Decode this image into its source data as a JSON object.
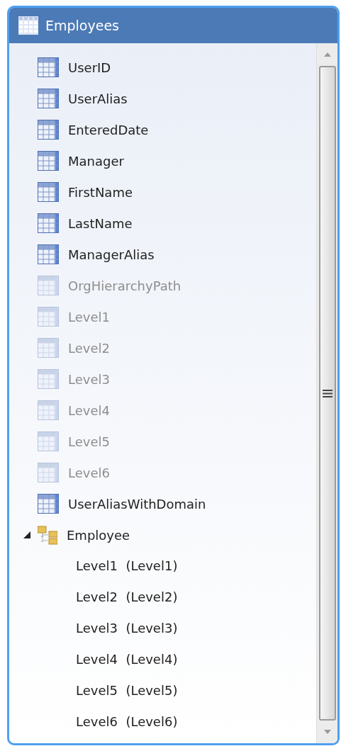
{
  "window": {
    "title": "Employees"
  },
  "attributes": [
    {
      "name": "UserID",
      "disabled": false
    },
    {
      "name": "UserAlias",
      "disabled": false
    },
    {
      "name": "EnteredDate",
      "disabled": false
    },
    {
      "name": "Manager",
      "disabled": false
    },
    {
      "name": "FirstName",
      "disabled": false
    },
    {
      "name": "LastName",
      "disabled": false
    },
    {
      "name": "ManagerAlias",
      "disabled": false
    },
    {
      "name": "OrgHierarchyPath",
      "disabled": true
    },
    {
      "name": "Level1",
      "disabled": true
    },
    {
      "name": "Level2",
      "disabled": true
    },
    {
      "name": "Level3",
      "disabled": true
    },
    {
      "name": "Level4",
      "disabled": true
    },
    {
      "name": "Level5",
      "disabled": true
    },
    {
      "name": "Level6",
      "disabled": true
    },
    {
      "name": "UserAliasWithDomain",
      "disabled": false
    }
  ],
  "hierarchies": [
    {
      "name": "Employee",
      "expanded": true,
      "children": [
        {
          "name": "Level1  (Level1)"
        },
        {
          "name": "Level2  (Level2)"
        },
        {
          "name": "Level3  (Level3)"
        },
        {
          "name": "Level4  (Level4)"
        },
        {
          "name": "Level5  (Level5)"
        },
        {
          "name": "Level6  (Level6)"
        }
      ]
    }
  ]
}
